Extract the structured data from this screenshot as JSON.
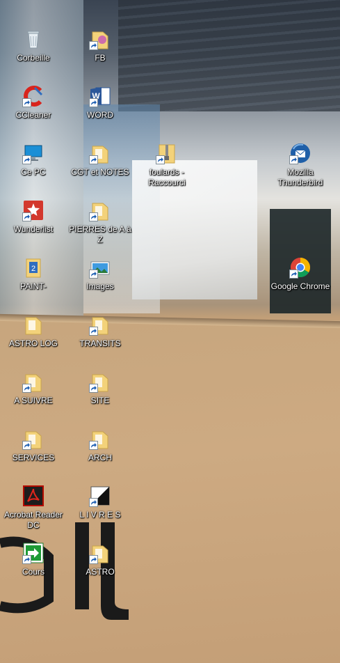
{
  "desktop": {
    "icons": [
      {
        "id": "corbeille",
        "label": "Corbeille",
        "icon": "recycle-bin-icon",
        "shortcut": false
      },
      {
        "id": "fb",
        "label": "FB",
        "icon": "folder-icon",
        "shortcut": true
      },
      {
        "id": "ccleaner",
        "label": "CCleaner",
        "icon": "ccleaner-icon",
        "shortcut": true
      },
      {
        "id": "word",
        "label": "WORD",
        "icon": "word-icon",
        "shortcut": true
      },
      {
        "id": "ce-pc",
        "label": "Ce PC",
        "icon": "computer-icon",
        "shortcut": true
      },
      {
        "id": "cgt-notes",
        "label": "CGT et NOTES",
        "icon": "folder-icon",
        "shortcut": true
      },
      {
        "id": "foulards",
        "label": "foulards - Raccourci",
        "icon": "zip-folder-icon",
        "shortcut": true
      },
      {
        "id": "thunderbird",
        "label": "Mozilla Thunderbird",
        "icon": "thunderbird-icon",
        "shortcut": true
      },
      {
        "id": "wunderlist",
        "label": "Wunderlist",
        "icon": "wunderlist-icon",
        "shortcut": true
      },
      {
        "id": "pierres",
        "label": "PIERRES de A à Z",
        "icon": "folder-icon",
        "shortcut": true
      },
      {
        "id": "paint",
        "label": "PAINT-",
        "icon": "paint-folder-icon",
        "shortcut": false
      },
      {
        "id": "images",
        "label": "Images",
        "icon": "images-icon",
        "shortcut": true
      },
      {
        "id": "chrome",
        "label": "Google Chrome",
        "icon": "chrome-icon",
        "shortcut": true
      },
      {
        "id": "astro-log",
        "label": "ASTRO LOG",
        "icon": "folder-icon",
        "shortcut": false
      },
      {
        "id": "transits",
        "label": "TRANSITS",
        "icon": "folder-icon",
        "shortcut": true
      },
      {
        "id": "a-suivre",
        "label": "A SUIVRE",
        "icon": "folder-icon",
        "shortcut": true
      },
      {
        "id": "site",
        "label": "SITE",
        "icon": "folder-icon",
        "shortcut": true
      },
      {
        "id": "services",
        "label": "SERVICES",
        "icon": "folder-icon",
        "shortcut": true
      },
      {
        "id": "arch",
        "label": "ARCH",
        "icon": "folder-icon",
        "shortcut": true
      },
      {
        "id": "acrobat",
        "label": "Acrobat Reader DC",
        "icon": "acrobat-icon",
        "shortcut": false
      },
      {
        "id": "livres",
        "label": "L I V R E S",
        "icon": "livres-icon",
        "shortcut": true
      },
      {
        "id": "cours",
        "label": "Cours",
        "icon": "cours-icon",
        "shortcut": true
      },
      {
        "id": "astro",
        "label": "ASTRO",
        "icon": "folder-icon",
        "shortcut": true
      }
    ]
  },
  "colors": {
    "label_text": "#ffffff",
    "folder_yellow": "#f3d27a",
    "word_blue": "#2b579a",
    "acrobat_red": "#b30b00",
    "cours_green": "#1e9b36"
  }
}
